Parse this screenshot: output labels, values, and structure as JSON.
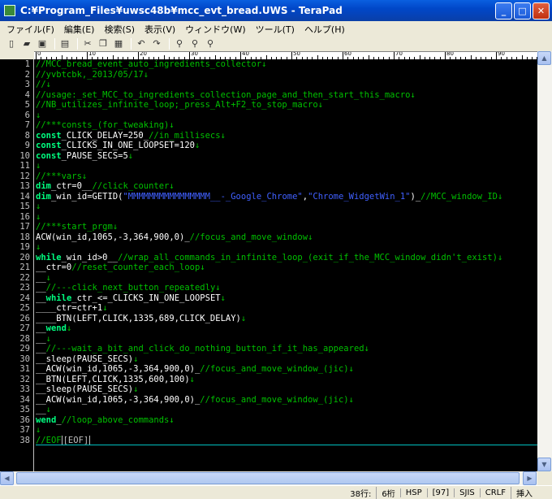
{
  "window": {
    "title": "C:¥Program_Files¥uwsc48b¥mcc_evt_bread.UWS - TeraPad",
    "minimize": "_",
    "maximize": "□",
    "close": "✕"
  },
  "menu": [
    "ファイル(F)",
    "編集(E)",
    "検索(S)",
    "表示(V)",
    "ウィンドウ(W)",
    "ツール(T)",
    "ヘルプ(H)"
  ],
  "toolbar_icons": [
    "new-icon",
    "open-icon",
    "save-icon",
    "print-icon",
    "cut-icon",
    "copy-icon",
    "paste-icon",
    "undo-icon",
    "redo-icon",
    "find-icon",
    "find-next-icon",
    "find-prev-icon"
  ],
  "ruler": [
    "0",
    "10",
    "20",
    "30",
    "40",
    "50",
    "60",
    "70",
    "80",
    "90"
  ],
  "line_numbers": [
    "1",
    "2",
    "3",
    "4",
    "5",
    "6",
    "7",
    "8",
    "9",
    "10",
    "11",
    "12",
    "13",
    "14",
    "15",
    "16",
    "17",
    "18",
    "19",
    "20",
    "21",
    "22",
    "23",
    "24",
    "25",
    "26",
    "27",
    "28",
    "29",
    "30",
    "31",
    "32",
    "33",
    "34",
    "35",
    "36",
    "37",
    "38"
  ],
  "code_lines": [
    [
      {
        "t": "//MCC_bread_event_auto_ingredients_collector",
        "c": "cm"
      },
      {
        "t": "↓",
        "c": "eol"
      }
    ],
    [
      {
        "t": "//yvbtcbk,_2013/05/17",
        "c": "cm"
      },
      {
        "t": "↓",
        "c": "eol"
      }
    ],
    [
      {
        "t": "//",
        "c": "cm"
      },
      {
        "t": "↓",
        "c": "eol"
      }
    ],
    [
      {
        "t": "//usage:_set_MCC_to_ingredients_collection_page_and_then_start_this_macro",
        "c": "cm"
      },
      {
        "t": "↓",
        "c": "eol"
      }
    ],
    [
      {
        "t": "//NB_utilizes_infinite_loop;_press_Alt+F2_to_stop_macro",
        "c": "cm"
      },
      {
        "t": "↓",
        "c": "eol"
      }
    ],
    [
      {
        "t": "↓",
        "c": "eol"
      }
    ],
    [
      {
        "t": "//***consts_(for_tweaking)",
        "c": "cm"
      },
      {
        "t": "↓",
        "c": "eol"
      }
    ],
    [
      {
        "t": "const",
        "c": "kw"
      },
      {
        "t": "_CLICK_DELAY=250_",
        "c": ""
      },
      {
        "t": "//in_millisecs",
        "c": "cm"
      },
      {
        "t": "↓",
        "c": "eol"
      }
    ],
    [
      {
        "t": "const",
        "c": "kw"
      },
      {
        "t": "_CLICKS_IN_ONE_LOOPSET=120",
        "c": ""
      },
      {
        "t": "↓",
        "c": "eol"
      }
    ],
    [
      {
        "t": "const",
        "c": "kw"
      },
      {
        "t": "_PAUSE_SECS=5",
        "c": ""
      },
      {
        "t": "↓",
        "c": "eol"
      }
    ],
    [
      {
        "t": "↓",
        "c": "eol"
      }
    ],
    [
      {
        "t": "//***vars",
        "c": "cm"
      },
      {
        "t": "↓",
        "c": "eol"
      }
    ],
    [
      {
        "t": "dim",
        "c": "kw"
      },
      {
        "t": "_ctr=0__",
        "c": ""
      },
      {
        "t": "//click_counter",
        "c": "cm"
      },
      {
        "t": "↓",
        "c": "eol"
      }
    ],
    [
      {
        "t": "dim",
        "c": "kw"
      },
      {
        "t": "_win_id=GETID(",
        "c": ""
      },
      {
        "t": "\"MMMMMMMMMMMMMMMM__-_Google_Chrome\"",
        "c": "st"
      },
      {
        "t": ",",
        "c": ""
      },
      {
        "t": "\"Chrome_WidgetWin_1\"",
        "c": "st"
      },
      {
        "t": ")_",
        "c": ""
      },
      {
        "t": "//MCC_window_ID",
        "c": "cm"
      },
      {
        "t": "↓",
        "c": "eol"
      }
    ],
    [
      {
        "t": "↓",
        "c": "eol"
      }
    ],
    [
      {
        "t": "↓",
        "c": "eol"
      }
    ],
    [
      {
        "t": "//***start_prgm",
        "c": "cm"
      },
      {
        "t": "↓",
        "c": "eol"
      }
    ],
    [
      {
        "t": "ACW(win_id,1065,-3,364,900,0)_",
        "c": ""
      },
      {
        "t": "//focus_and_move_window",
        "c": "cm"
      },
      {
        "t": "↓",
        "c": "eol"
      }
    ],
    [
      {
        "t": "↓",
        "c": "eol"
      }
    ],
    [
      {
        "t": "while",
        "c": "kw"
      },
      {
        "t": "_win_id>0__",
        "c": ""
      },
      {
        "t": "//wrap_all_commands_in_infinite_loop_(exit_if_the_MCC_window_didn't_exist)",
        "c": "cm"
      },
      {
        "t": "↓",
        "c": "eol"
      }
    ],
    [
      {
        "t": "__ctr=0",
        "c": ""
      },
      {
        "t": "//reset_counter_each_loop",
        "c": "cm"
      },
      {
        "t": "↓",
        "c": "eol"
      }
    ],
    [
      {
        "t": "__",
        "c": ""
      },
      {
        "t": "↓",
        "c": "eol"
      }
    ],
    [
      {
        "t": "__",
        "c": ""
      },
      {
        "t": "//---click_next_button_repeatedly",
        "c": "cm"
      },
      {
        "t": "↓",
        "c": "eol"
      }
    ],
    [
      {
        "t": "__",
        "c": ""
      },
      {
        "t": "while",
        "c": "kw"
      },
      {
        "t": "_ctr_<=_CLICKS_IN_ONE_LOOPSET",
        "c": ""
      },
      {
        "t": "↓",
        "c": "eol"
      }
    ],
    [
      {
        "t": "____ctr=ctr+1",
        "c": ""
      },
      {
        "t": "↓",
        "c": "eol"
      }
    ],
    [
      {
        "t": "____BTN(LEFT,CLICK,1335,689,CLICK_DELAY)",
        "c": ""
      },
      {
        "t": "↓",
        "c": "eol"
      }
    ],
    [
      {
        "t": "__",
        "c": ""
      },
      {
        "t": "wend",
        "c": "kw"
      },
      {
        "t": "↓",
        "c": "eol"
      }
    ],
    [
      {
        "t": "__",
        "c": ""
      },
      {
        "t": "↓",
        "c": "eol"
      }
    ],
    [
      {
        "t": "__",
        "c": ""
      },
      {
        "t": "//---wait_a_bit_and_click_do_nothing_button_if_it_has_appeared",
        "c": "cm"
      },
      {
        "t": "↓",
        "c": "eol"
      }
    ],
    [
      {
        "t": "__sleep(PAUSE_SECS)",
        "c": ""
      },
      {
        "t": "↓",
        "c": "eol"
      }
    ],
    [
      {
        "t": "__ACW(win_id,1065,-3,364,900,0)_",
        "c": ""
      },
      {
        "t": "//focus_and_move_window_(jic)",
        "c": "cm"
      },
      {
        "t": "↓",
        "c": "eol"
      }
    ],
    [
      {
        "t": "__BTN(LEFT,CLICK,1335,600,100)",
        "c": ""
      },
      {
        "t": "↓",
        "c": "eol"
      }
    ],
    [
      {
        "t": "__sleep(PAUSE_SECS)",
        "c": ""
      },
      {
        "t": "↓",
        "c": "eol"
      }
    ],
    [
      {
        "t": "__ACW(win_id,1065,-3,364,900,0)_",
        "c": ""
      },
      {
        "t": "//focus_and_move_window_(jic)",
        "c": "cm"
      },
      {
        "t": "↓",
        "c": "eol"
      }
    ],
    [
      {
        "t": "__",
        "c": ""
      },
      {
        "t": "↓",
        "c": "eol"
      }
    ],
    [
      {
        "t": "wend",
        "c": "kw"
      },
      {
        "t": "_",
        "c": ""
      },
      {
        "t": "//loop_above_commands",
        "c": "cm"
      },
      {
        "t": "↓",
        "c": "eol"
      }
    ],
    [
      {
        "t": "↓",
        "c": "eol"
      }
    ],
    [
      {
        "t": "//EOF",
        "c": "cm"
      },
      {
        "t": "[EOF]",
        "c": "eofbox"
      }
    ]
  ],
  "status": {
    "line": "38行:",
    "col": "6桁",
    "hsp": "HSP",
    "num": "[97]",
    "encoding": "SJIS",
    "newline": "CRLF",
    "mode": "挿入"
  },
  "colors": {
    "background": "#000000",
    "comment": "#00c000",
    "keyword": "#00ff80",
    "string": "#4060ff",
    "titlebar": "#0047c8"
  }
}
